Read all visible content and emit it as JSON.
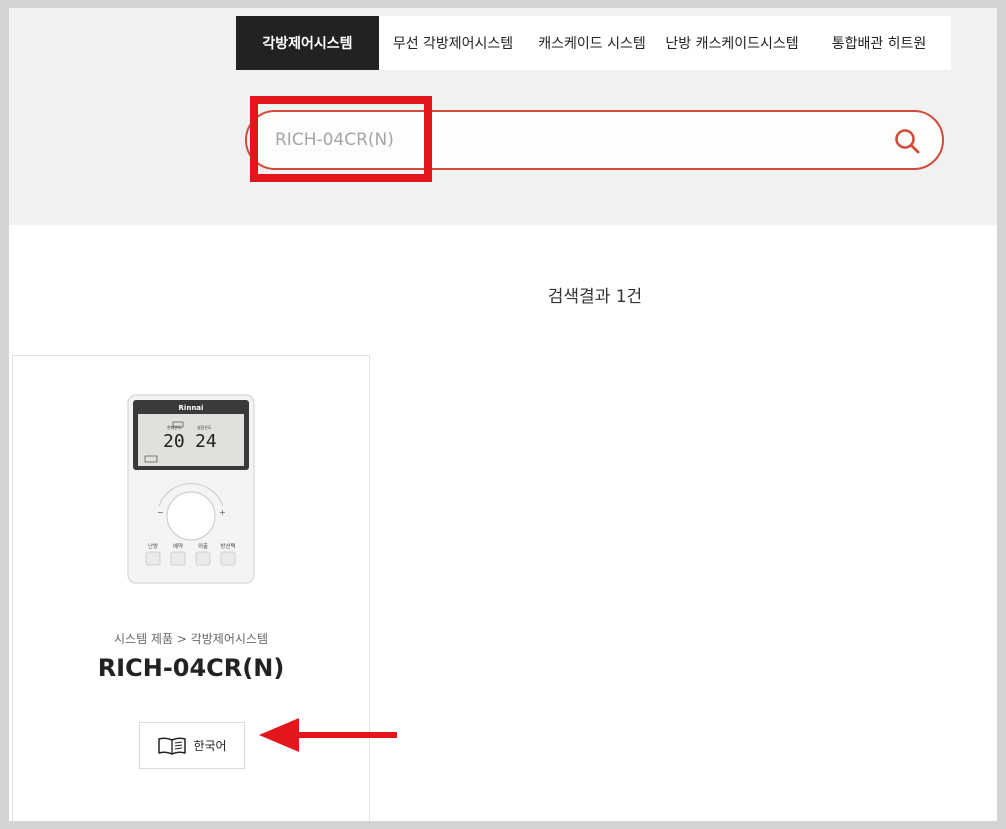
{
  "tabs": [
    {
      "label": "각방제어시스템",
      "active": true
    },
    {
      "label": "무선 각방제어시스템",
      "active": false
    },
    {
      "label": "캐스케이드 시스템",
      "active": false
    },
    {
      "label": "난방 캐스케이드시스템",
      "active": false
    },
    {
      "label": "통합배관 히트원",
      "active": false
    }
  ],
  "search": {
    "placeholder": "RICH-04CR(N)",
    "icon": "search-icon"
  },
  "results": {
    "count_text": "검색결과 1건"
  },
  "product": {
    "category": "시스템 제품 > 각방제어시스템",
    "model": "RICH-04CR(N)",
    "manual_label": "한국어",
    "device": {
      "brand": "Rinnai",
      "current_temp": "20",
      "set_temp": "24",
      "current_label": "현재온도",
      "set_label": "설정온도",
      "buttons": [
        "난방",
        "예약",
        "외출",
        "방선택"
      ]
    }
  },
  "colors": {
    "accent": "#d24b3a",
    "annotation": "#e2161b",
    "tab_active_bg": "#222222"
  }
}
